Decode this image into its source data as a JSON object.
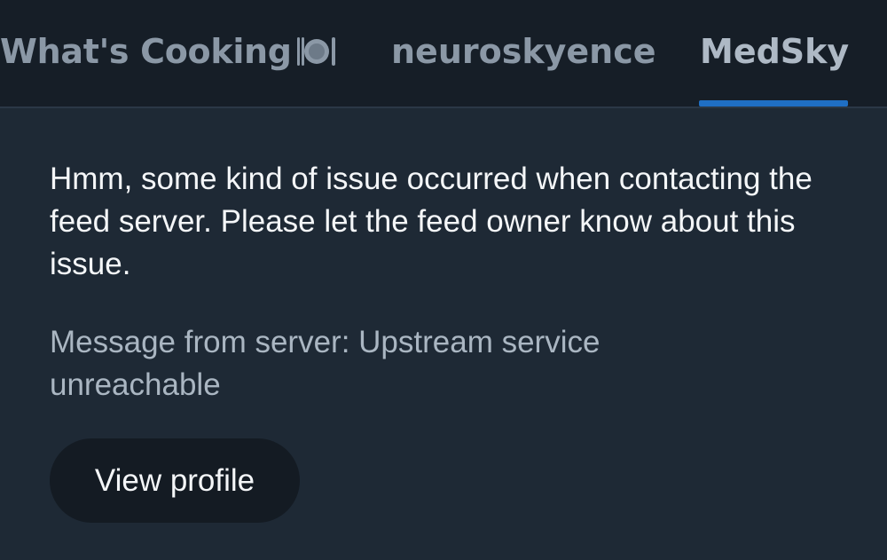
{
  "tabs": [
    {
      "label": "What's Cooking",
      "icon": "plate-cutlery-icon",
      "selected": false
    },
    {
      "label": "neuroskyence",
      "selected": false
    },
    {
      "label": "MedSky",
      "selected": true
    }
  ],
  "colors": {
    "background": "#1e2935",
    "tabbar_background": "#161e27",
    "active_indicator": "#1f6fc4",
    "primary_text": "#f4f6f8",
    "secondary_text": "#aab6c2",
    "button_background": "#141b23"
  },
  "feed_error": {
    "message": "Hmm, some kind of issue occurred when contacting the feed server. Please let the feed owner know about this issue.",
    "server_message": "Message from server: Upstream service unreachable",
    "button_label": "View profile"
  }
}
